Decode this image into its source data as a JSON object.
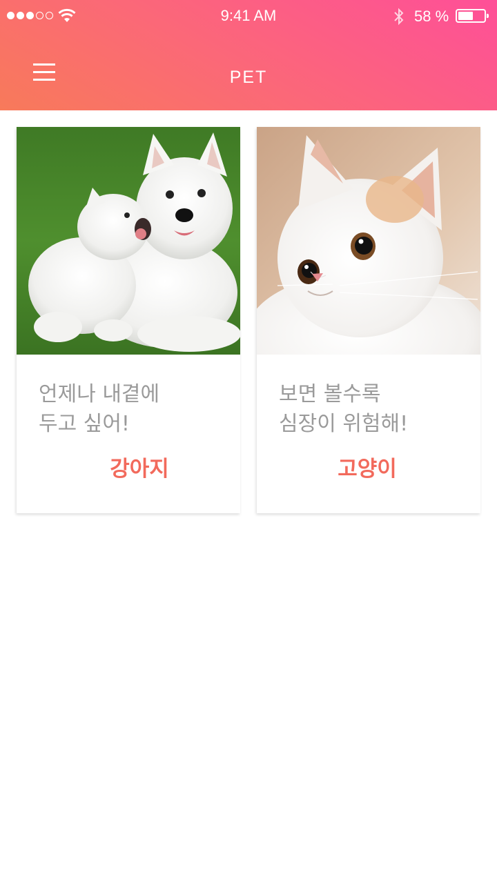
{
  "status_bar": {
    "time": "9:41 AM",
    "battery_percent_text": "58 %",
    "battery_level": 0.58,
    "signal_bars_filled": 3,
    "signal_bars_total": 5,
    "icons": [
      "signal-dots-icon",
      "wifi-icon",
      "bluetooth-icon",
      "battery-icon"
    ]
  },
  "header": {
    "title": "PET",
    "menu_icon": "hamburger-menu-icon",
    "gradient_colors": [
      "#f87a5a",
      "#fe4f98"
    ]
  },
  "cards": [
    {
      "id": "dog",
      "image": "two white samoyed dogs on grass",
      "description": "언제나 내곁에\n두고 싶어!",
      "name": "강아지"
    },
    {
      "id": "cat",
      "image": "white and orange kitten face",
      "description": "보면 볼수록\n심장이 위험해!",
      "name": "고양이"
    }
  ],
  "colors": {
    "accent": "#f26a5c",
    "description_text": "#9a9a9a"
  }
}
